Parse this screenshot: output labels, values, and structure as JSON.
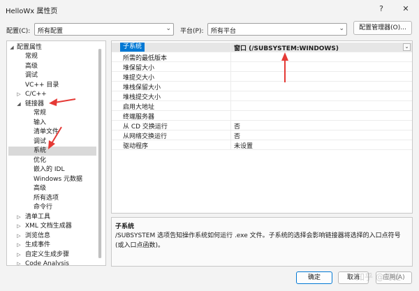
{
  "window": {
    "title": "HelloWx 属性页",
    "help_glyph": "?",
    "close_glyph": "✕"
  },
  "config_bar": {
    "config_label": "配置(C):",
    "config_value": "所有配置",
    "platform_label": "平台(P):",
    "platform_value": "所有平台",
    "manager_button": "配置管理器(O)..."
  },
  "tree": [
    {
      "label": "配置属性",
      "toggle": "◢"
    },
    {
      "label": "常规"
    },
    {
      "label": "高级"
    },
    {
      "label": "调试"
    },
    {
      "label": "VC++ 目录"
    },
    {
      "label": "C/C++",
      "toggle": "▷"
    },
    {
      "label": "链接器",
      "toggle": "◢"
    },
    {
      "label": "常规"
    },
    {
      "label": "输入"
    },
    {
      "label": "清单文件"
    },
    {
      "label": "调试"
    },
    {
      "label": "系统",
      "selected": true
    },
    {
      "label": "优化"
    },
    {
      "label": "嵌入的 IDL"
    },
    {
      "label": "Windows 元数据"
    },
    {
      "label": "高级"
    },
    {
      "label": "所有选项"
    },
    {
      "label": "命令行"
    },
    {
      "label": "清单工具",
      "toggle": "▷"
    },
    {
      "label": "XML 文档生成器",
      "toggle": "▷"
    },
    {
      "label": "浏览信息",
      "toggle": "▷"
    },
    {
      "label": "生成事件",
      "toggle": "▷"
    },
    {
      "label": "自定义生成步骤",
      "toggle": "▷"
    },
    {
      "label": "Code Analysis",
      "toggle": "▷"
    }
  ],
  "properties": [
    {
      "name": "子系统",
      "value": "窗口 (/SUBSYSTEM:WINDOWS)",
      "selected": true
    },
    {
      "name": "所需的最低版本",
      "value": ""
    },
    {
      "name": "堆保留大小",
      "value": ""
    },
    {
      "name": "堆提交大小",
      "value": ""
    },
    {
      "name": "堆栈保留大小",
      "value": ""
    },
    {
      "name": "堆栈提交大小",
      "value": ""
    },
    {
      "name": "启用大地址",
      "value": ""
    },
    {
      "name": "终端服务器",
      "value": ""
    },
    {
      "name": "从 CD 交换运行",
      "value": "否"
    },
    {
      "name": "从网络交换运行",
      "value": "否"
    },
    {
      "name": "驱动程序",
      "value": "未设置"
    }
  ],
  "description": {
    "title": "子系统",
    "text": "/SUBSYSTEM 选项告知操作系统如何运行 .exe 文件。子系统的选择会影响链接器将选择的入口点符号(或入口点函数)。"
  },
  "buttons": {
    "ok": "确定",
    "cancel": "取消",
    "apply": "应用(A)"
  },
  "watermark": "知乎 @司徒",
  "colors": {
    "accent": "#0078d4",
    "annotation_arrow": "#e53935"
  }
}
